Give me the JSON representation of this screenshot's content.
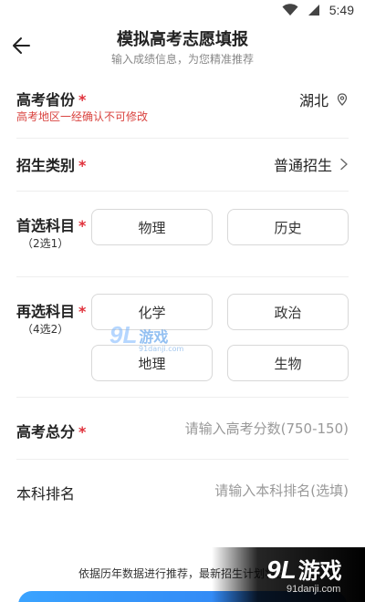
{
  "status_bar": {
    "time": "5:49",
    "icons": [
      "wifi-icon",
      "signal-icon"
    ]
  },
  "header": {
    "back_icon": "arrow-left-icon",
    "title": "模拟高考志愿填报",
    "subtitle": "输入成绩信息，为您精准推荐"
  },
  "form": {
    "province": {
      "label": "高考省份",
      "required": "*",
      "value": "湖北",
      "icon": "location-pin-icon",
      "warning": "高考地区一经确认不可修改"
    },
    "category": {
      "label": "招生类别",
      "required": "*",
      "value": "普通招生",
      "icon": "chevron-right-icon"
    },
    "first_subject": {
      "label": "首选科目",
      "required": "*",
      "hint": "（2选1）",
      "options": [
        "物理",
        "历史"
      ]
    },
    "second_subject": {
      "label": "再选科目",
      "required": "*",
      "hint": "（4选2）",
      "options": [
        "化学",
        "政治",
        "地理",
        "生物"
      ]
    },
    "score": {
      "label": "高考总分",
      "required": "*",
      "placeholder": "请输入高考分数(750-150)"
    },
    "rank": {
      "label": "本科排名",
      "placeholder": "请输入本科排名(选填)"
    }
  },
  "footer": {
    "note": "依据历年数据进行推荐，最新招生计划将在"
  },
  "watermark": {
    "center_logo": "9L",
    "center_name": "游戏",
    "center_url": "91danji.com",
    "corner_logo": "9L",
    "corner_name": "游戏",
    "corner_url": "91danji.com"
  },
  "colors": {
    "accent": "#2e7bf0",
    "required": "#e0303a",
    "warning": "#d9433f"
  }
}
